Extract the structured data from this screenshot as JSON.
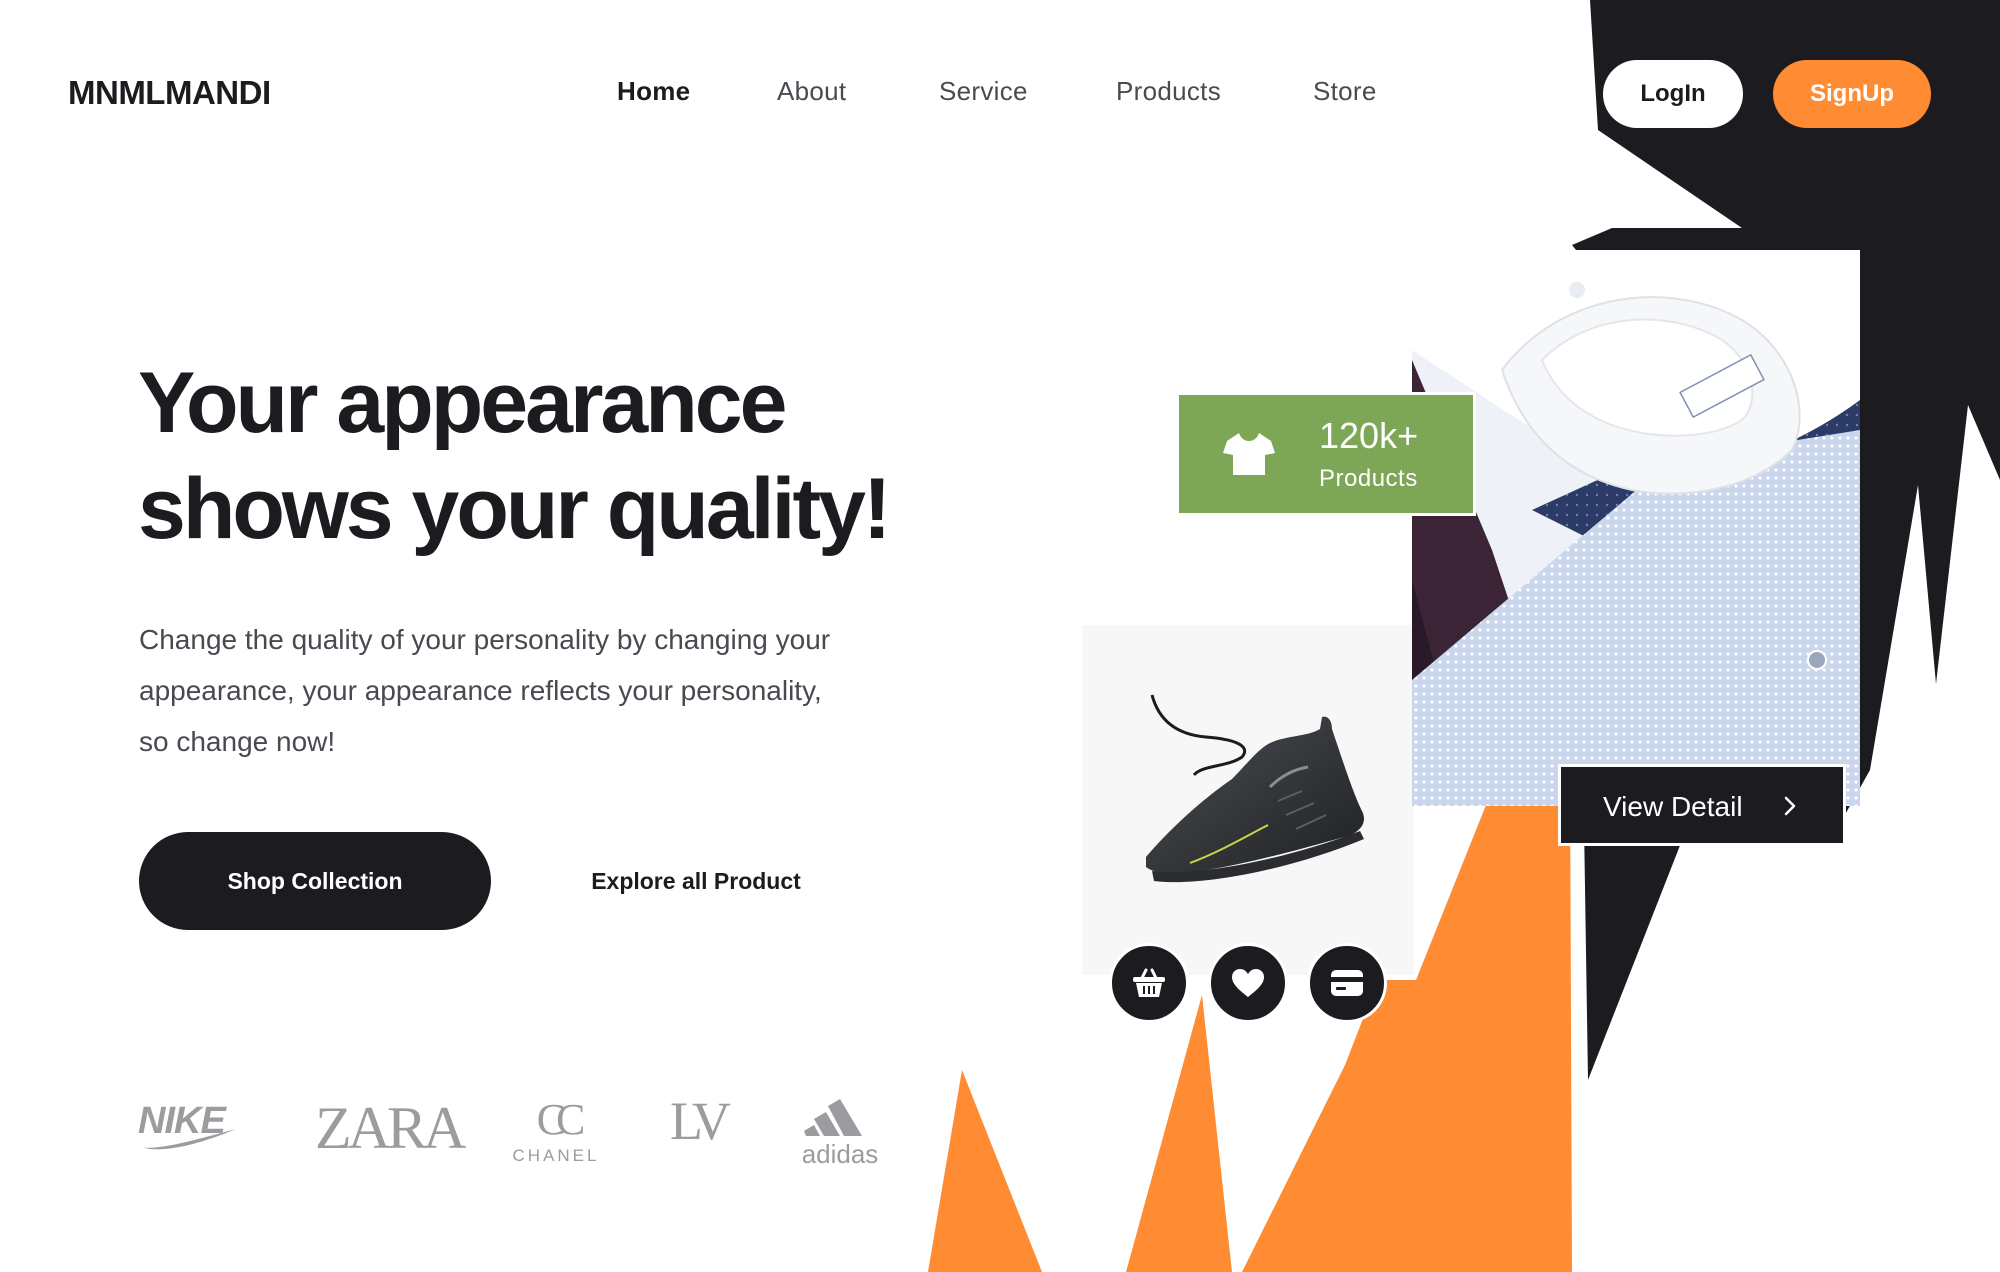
{
  "header": {
    "brand": "MNMLMANDI",
    "nav": [
      {
        "label": "Home",
        "active": true
      },
      {
        "label": "About",
        "active": false
      },
      {
        "label": "Service",
        "active": false
      },
      {
        "label": "Products",
        "active": false
      },
      {
        "label": "Store",
        "active": false
      }
    ],
    "login_label": "LogIn",
    "signup_label": "SignUp"
  },
  "hero": {
    "headline_line1": "Your appearance",
    "headline_line2": "shows your quality!",
    "subtext_line1": "Change the quality of your personality by changing your",
    "subtext_line2": "appearance, your appearance reflects your personality,",
    "subtext_line3": "so change now!",
    "primary_cta": "Shop Collection",
    "secondary_cta": "Explore all Product"
  },
  "brands": {
    "nike": "NIKE",
    "zara": "ZARA",
    "chanel_mark": "CC",
    "chanel": "CHANEL",
    "lv_mark": "LV",
    "adidas": "adidas"
  },
  "showcase": {
    "stat_value": "120k+",
    "stat_label": "Products",
    "stat_icon": "tshirt-icon",
    "view_detail_label": "View Detail",
    "action_icons": [
      "basket-icon",
      "heart-icon",
      "card-icon"
    ]
  },
  "colors": {
    "accent_orange": "#ff8b33",
    "dark": "#1c1b1f",
    "stat_green": "#7da756",
    "logo_gray": "#9c9b9f"
  }
}
